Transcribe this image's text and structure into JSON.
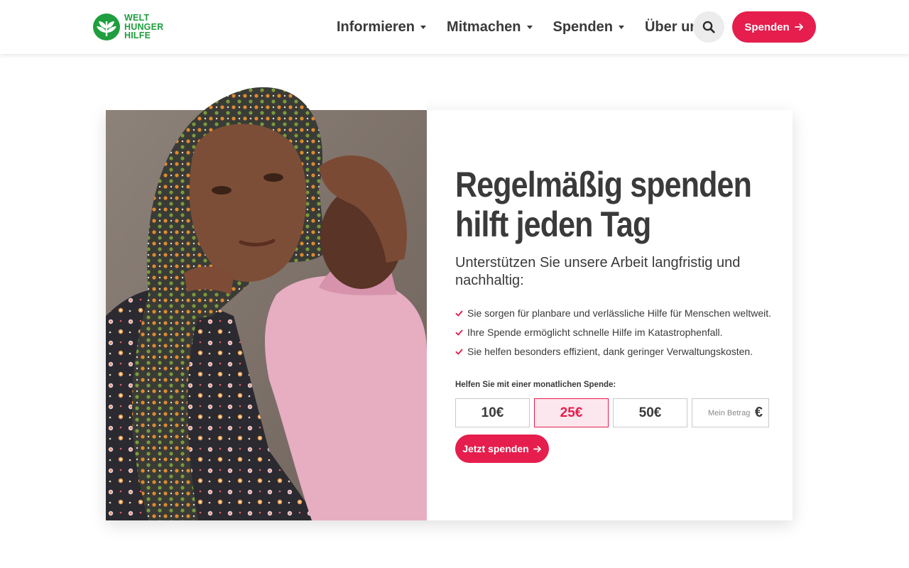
{
  "logo": {
    "lines": [
      "WELT",
      "HUNGER",
      "HILFE"
    ],
    "icon": "leaf-globe-logo",
    "color": "#1e9e3e"
  },
  "nav": {
    "items": [
      {
        "label": "Informieren"
      },
      {
        "label": "Mitmachen"
      },
      {
        "label": "Spenden"
      },
      {
        "label": "Über uns"
      }
    ],
    "search_icon": "search-icon",
    "donate_label": "Spenden"
  },
  "hero": {
    "headline": "Regelmäßig spenden hilft jeden Tag",
    "subline": "Unterstützen Sie unsere Arbeit langfristig und nachhaltig:",
    "benefits": [
      "Sie sorgen für planbare und verlässliche Hilfe für Menschen weltweit.",
      "Ihre Spende ermöglicht schnelle Hilfe im Katastrophenfall.",
      "Sie helfen besonders effizient, dank geringer Verwaltungskosten."
    ],
    "amount_label": "Helfen Sie mit einer monatlichen Spende:",
    "amounts": [
      "10€",
      "25€",
      "50€"
    ],
    "selected_amount": "25€",
    "own_amount_placeholder": "Mein Betrag",
    "currency": "€",
    "submit_label": "Jetzt spenden"
  },
  "colors": {
    "accent": "#e51e4d",
    "text": "#3a3a3a",
    "brand_green": "#1e9e3e"
  }
}
